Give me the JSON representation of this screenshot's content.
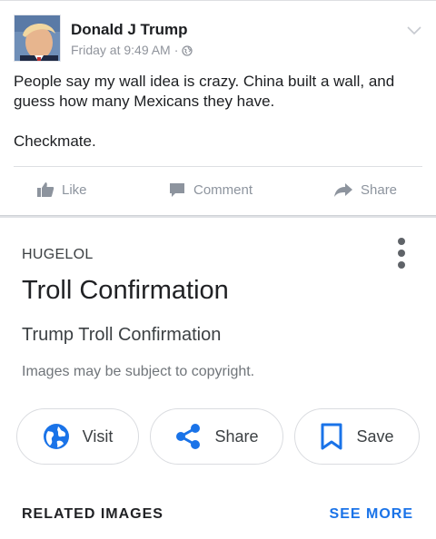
{
  "post": {
    "author": "Donald J Trump",
    "time": "Friday at 9:49 AM",
    "separator": "·",
    "privacy_icon": "globe-icon",
    "body_paragraph_1": "People say my wall idea is crazy. China built a wall, and guess how many Mexicans they have.",
    "body_paragraph_2": "Checkmate.",
    "actions": {
      "like_label": "Like",
      "comment_label": "Comment",
      "share_label": "Share"
    }
  },
  "image_panel": {
    "source": "HUGELOL",
    "title": "Troll Confirmation",
    "subtitle": "Trump Troll Confirmation",
    "copyright_note": "Images may be subject to copyright.",
    "buttons": {
      "visit_label": "Visit",
      "share_label": "Share",
      "save_label": "Save"
    },
    "related_label": "RELATED IMAGES",
    "see_more_label": "SEE MORE"
  },
  "colors": {
    "accent_blue": "#1a73e8",
    "fb_gray": "#8d949e",
    "text_dark": "#1c1e21"
  }
}
